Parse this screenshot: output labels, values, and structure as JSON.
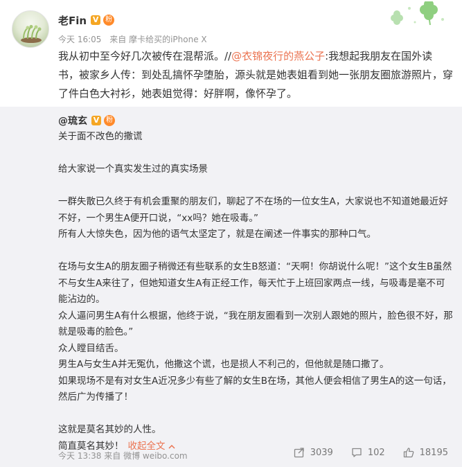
{
  "post": {
    "username": "老Fin",
    "verified_badge": "V",
    "fan_badge": "粉",
    "time": "今天 16:05",
    "source_prefix": "来自",
    "source": "摩卡给买的iPhone X",
    "text_part1": "我从初中至今好几次被传在混帮派。//",
    "mention": "@衣锦夜行的燕公子",
    "text_part2": ":我想起我朋友在国外读书，被家乡人传：到处乱搞怀孕堕胎，源头就是她表姐看到她一张朋友圈旅游照片，穿了件白色大衬衫，她表姐觉得：好胖啊，像怀孕了。"
  },
  "repost": {
    "username": "@琉玄",
    "verified_badge": "V",
    "fan_badge": "粉",
    "lines": [
      "关于面不改色的撒谎",
      "",
      "给大家说一个真实发生过的真实场景",
      "",
      "一群失散已久终于有机会重聚的朋友们，聊起了不在场的一位女生A，大家说也不知道她最近好不好，一个男生A便开口说，“xx吗？她在吸毒。”",
      "所有人大惊失色，因为他的语气太坚定了，就是在阐述一件事实的那种口气。",
      "",
      "在场与女生A的朋友圈子稍微还有些联系的女生B怒道：“天啊！你胡说什么呢！”这个女生B虽然不与女生A来往了，但她知道女生A有正经工作，每天忙于上班回家两点一线，与吸毒是毫不可能沾边的。",
      "众人逼问男生A有什么根据，他终于说，“我在朋友圈看到一次别人跟她的照片，脸色很不好，那就是吸毒的脸色。”",
      "众人瞠目结舌。",
      "男生A与女生A并无冤仇，他撒这个谎，也是损人不利己的，但他就是随口撒了。",
      "如果现场不是有对女生A近况多少有些了解的女生B在场，其他人便会相信了男生A的这一句话，然后广为传播了！",
      "",
      "这就是莫名其妙的人性。"
    ],
    "last_line": "简直莫名其妙！",
    "collapse_label": "收起全文",
    "time": "今天 13:38",
    "source_prefix": "来自",
    "source": "微博 weibo.com",
    "share_count": "3039",
    "comment_count": "102",
    "like_count": "18195"
  },
  "colors": {
    "accent": "#eb7350",
    "meta": "#939393",
    "repost_bg": "#f2f2f5",
    "badge": "#f5a623"
  },
  "icons": {
    "share": "share-icon",
    "comment": "comment-icon",
    "like": "like-icon",
    "clover": "clover-icon",
    "collapse": "chevron-up-icon"
  }
}
